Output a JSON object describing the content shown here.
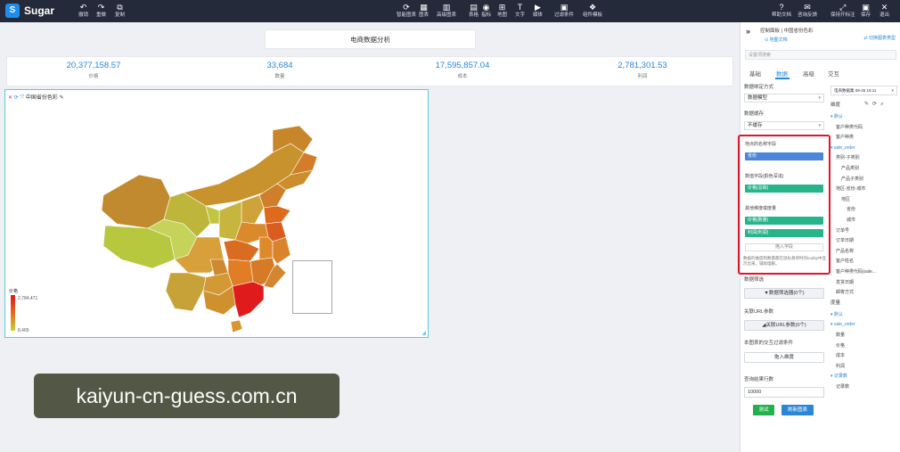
{
  "app": {
    "brand": "Sugar",
    "logo": "S"
  },
  "toolbar_left": [
    {
      "label": "撤销",
      "icon": "↶"
    },
    {
      "label": "重做",
      "icon": "↷"
    },
    {
      "label": "复制",
      "icon": "⧉"
    }
  ],
  "toolbar_center": [
    {
      "label": "智能图表",
      "icon": "⟳"
    },
    {
      "label": "图表",
      "icon": "▦"
    },
    {
      "label": "高级图表",
      "icon": "▥"
    },
    {
      "label": "表格",
      "icon": "▤"
    },
    {
      "label": "指标",
      "icon": "◉"
    },
    {
      "label": "地图",
      "icon": "⊞"
    },
    {
      "label": "文字",
      "icon": "T"
    },
    {
      "label": "媒体",
      "icon": "▶"
    },
    {
      "label": "过滤条件",
      "icon": "▣"
    },
    {
      "label": "组件模板",
      "icon": "❖"
    }
  ],
  "toolbar_right": [
    {
      "label": "帮助文档",
      "icon": "?"
    },
    {
      "label": "咨询反馈",
      "icon": "✉"
    },
    {
      "label": "保持开标注",
      "icon": "⤢"
    },
    {
      "label": "保存",
      "icon": "▣"
    },
    {
      "label": "退出",
      "icon": "✕"
    }
  ],
  "canvas": {
    "title": "电商数据分析",
    "kpis": [
      {
        "value": "20,377,158.57",
        "label": "价格"
      },
      {
        "value": "33,684",
        "label": "数量"
      },
      {
        "value": "17,595,857.04",
        "label": "成本"
      },
      {
        "value": "2,781,301.53",
        "label": "利润"
      }
    ],
    "map": {
      "title": "中国省份色彩",
      "legend_title": "价格",
      "legend_max": "2,784,471",
      "legend_min": "8,465"
    }
  },
  "watermark": "kaiyun-cn-guess.com.cn",
  "panel": {
    "header_icon": "»",
    "title": "控制面板 | 中国省份色彩",
    "doc_link": "⊙ 地图文档",
    "switch_link": "⇄ 切换图表类型",
    "search_placeholder": "设置项搜索",
    "tabs": [
      "基础",
      "数据",
      "高级",
      "交互"
    ],
    "bind_label": "数据绑定方式",
    "bind_value": "数据模型",
    "cache_label": "数据缓存",
    "cache_value": "不缓存",
    "location_label": "地点的名称字段",
    "location_chip": "省份",
    "value_label": "数值字段(颜色深浅)",
    "value_chip": "价格(总和)",
    "other_label": "其他维度或度量",
    "other_chips": [
      "价格(数量)",
      "利润(利润)"
    ],
    "add_label": "拖入字段",
    "hint": "数据的维度和数量都在鼠标悬停时的tooltip中显示出来，辅助理解。",
    "filter_label": "数据筛选",
    "filter_btn": "▼数据筛选器(0个)",
    "url_label": "关联URL参数",
    "url_btn": "◢关联URL参数(0个)",
    "interact_label": "本图表的交互过滤条件",
    "interact_btn": "拖入维度",
    "limit_label": "查询结果行数",
    "limit_value": "10000",
    "test_btn": "测试",
    "refresh_btn": "刷新图表"
  },
  "fields": {
    "dataset": "电商数据集 09-26 19:11",
    "dim_header": "维度",
    "tree": [
      {
        "text": "▾ 默认",
        "kind": "folder",
        "indent": 0
      },
      {
        "text": "客户种类代码",
        "kind": "field",
        "indent": 1
      },
      {
        "text": "客户种类",
        "kind": "field",
        "indent": 1
      },
      {
        "text": "▾ sale_order",
        "kind": "folder",
        "indent": 0
      },
      {
        "text": "类别-子类别",
        "kind": "field",
        "indent": 1
      },
      {
        "text": "产品类别",
        "kind": "field",
        "indent": 2
      },
      {
        "text": "产品子类别",
        "kind": "field",
        "indent": 2
      },
      {
        "text": "地区-省份-城市",
        "kind": "field",
        "indent": 1
      },
      {
        "text": "地区",
        "kind": "field",
        "indent": 2
      },
      {
        "text": "省份",
        "kind": "field",
        "indent": 3
      },
      {
        "text": "城市",
        "kind": "field",
        "indent": 3
      },
      {
        "text": "订单号",
        "kind": "field",
        "indent": 1
      },
      {
        "text": "订单日期",
        "kind": "field",
        "indent": 1
      },
      {
        "text": "产品名称",
        "kind": "field",
        "indent": 1
      },
      {
        "text": "客户姓名",
        "kind": "field",
        "indent": 1
      },
      {
        "text": "客户种类代码(sale...",
        "kind": "field",
        "indent": 1
      },
      {
        "text": "发货日期",
        "kind": "field",
        "indent": 1
      },
      {
        "text": "邮寄方式",
        "kind": "field",
        "indent": 1
      },
      {
        "text": "度量",
        "kind": "header",
        "indent": 0
      },
      {
        "text": "▾ 默认",
        "kind": "folder",
        "indent": 0
      },
      {
        "text": "▾ sale_order",
        "kind": "folder",
        "indent": 0
      },
      {
        "text": "数量",
        "kind": "field",
        "indent": 1
      },
      {
        "text": "价格",
        "kind": "field",
        "indent": 1
      },
      {
        "text": "成本",
        "kind": "field",
        "indent": 1
      },
      {
        "text": "利润",
        "kind": "field",
        "indent": 1
      },
      {
        "text": "▾ 记录数",
        "kind": "folder",
        "indent": 0
      },
      {
        "text": "记录数",
        "kind": "field",
        "indent": 1
      }
    ]
  }
}
